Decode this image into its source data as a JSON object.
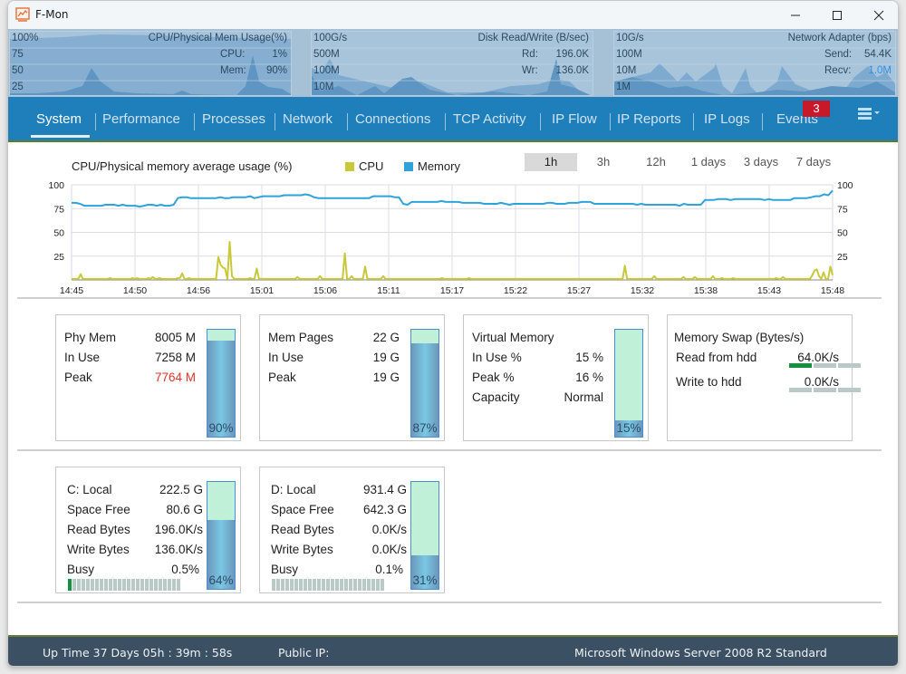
{
  "window": {
    "title": "F-Mon",
    "controls": {
      "minimize": "—",
      "maximize": "☐",
      "close": "✕"
    }
  },
  "mini_charts": [
    {
      "title": "CPU/Physical Mem Usage(%)",
      "ticks": [
        "100%",
        "75",
        "50",
        "25"
      ],
      "stats": [
        {
          "label": "CPU:",
          "value": "1%"
        },
        {
          "label": "Mem:",
          "value": "90%"
        }
      ]
    },
    {
      "title": "Disk Read/Write (B/sec)",
      "ticks": [
        "100G/s",
        "500M",
        "100M",
        "10M"
      ],
      "stats": [
        {
          "label": "Rd:",
          "value": "196.0K"
        },
        {
          "label": "Wr:",
          "value": "136.0K"
        }
      ]
    },
    {
      "title": "Network Adapter (bps)",
      "ticks": [
        "10G/s",
        "100M",
        "10M",
        "1M"
      ],
      "stats": [
        {
          "label": "Send:",
          "value": "54.4K"
        },
        {
          "label": "Recv:",
          "value": "1.0M",
          "color": "#2f8de4"
        }
      ]
    }
  ],
  "nav": {
    "tabs": [
      {
        "label": "System",
        "active": true
      },
      {
        "label": "Performance"
      },
      {
        "label": "Processes"
      },
      {
        "label": "Network"
      },
      {
        "label": "Connections"
      },
      {
        "label": "TCP Activity"
      },
      {
        "label": "IP Flow"
      },
      {
        "label": "IP Reports"
      },
      {
        "label": "IP Logs"
      },
      {
        "label": "Events"
      }
    ],
    "events_badge": "3",
    "menu_icon": "hamburger-menu-icon"
  },
  "usage_chart": {
    "title": "CPU/Physical memory average usage (%)",
    "legend": [
      {
        "label": "CPU",
        "color": "#c8c83a"
      },
      {
        "label": "Memory",
        "color": "#2ea2d9"
      }
    ],
    "ranges": [
      {
        "label": "1h",
        "active": true
      },
      {
        "label": "3h"
      },
      {
        "label": "12h"
      },
      {
        "label": "1 days"
      },
      {
        "label": "3 days"
      },
      {
        "label": "7 days"
      }
    ]
  },
  "chart_data": {
    "type": "line",
    "title": "CPU/Physical memory average usage (%)",
    "xlabel": "",
    "ylabel": "",
    "ylim": [
      0,
      100
    ],
    "y_ticks": [
      100,
      75,
      50,
      25
    ],
    "x_ticks": [
      "14:45",
      "14:50",
      "14:56",
      "15:01",
      "15:06",
      "15:11",
      "15:17",
      "15:22",
      "15:27",
      "15:32",
      "15:38",
      "15:43",
      "15:48"
    ],
    "grid": true,
    "legend_position": "top",
    "series": [
      {
        "name": "Memory",
        "color": "#2ea2d9",
        "values": [
          81,
          81,
          80,
          78,
          78,
          78,
          78,
          78,
          79,
          79,
          79,
          78,
          79,
          78,
          78,
          78,
          77,
          78,
          79,
          79,
          78,
          79,
          78,
          78,
          79,
          86,
          87,
          87,
          86,
          86,
          86,
          86,
          86,
          86,
          86,
          87,
          86,
          86,
          87,
          87,
          87,
          87,
          88,
          86,
          87,
          88,
          88,
          88,
          88,
          88,
          89,
          89,
          89,
          89,
          89,
          90,
          89,
          87,
          86,
          86,
          86,
          86,
          86,
          86,
          86,
          86,
          86,
          86,
          86,
          86,
          86,
          88,
          88,
          88,
          88,
          88,
          87,
          87,
          80,
          79,
          82,
          82,
          82,
          82,
          82,
          82,
          82,
          83,
          82,
          82,
          82,
          82,
          81,
          81,
          81,
          81,
          81,
          80,
          80,
          80,
          80,
          81,
          80,
          79,
          80,
          80,
          80,
          80,
          80,
          80,
          80,
          80,
          81,
          81,
          80,
          80,
          80,
          81,
          81,
          81,
          82,
          82,
          82,
          80,
          80,
          80,
          80,
          80,
          80,
          80,
          80,
          80,
          80,
          79,
          80,
          79,
          79,
          79,
          79,
          79,
          79,
          79,
          79,
          78,
          80,
          79,
          79,
          79,
          79,
          84,
          84,
          84,
          85,
          85,
          85,
          84,
          85,
          85,
          85,
          85,
          85,
          85,
          85,
          84,
          85,
          84,
          84,
          84,
          84,
          84,
          86,
          86,
          86,
          86,
          87,
          88,
          88,
          90,
          89,
          94
        ]
      },
      {
        "name": "CPU",
        "color": "#c8c83a",
        "values": [
          1,
          1,
          1,
          1,
          6,
          1,
          1,
          1,
          1,
          1,
          1,
          1,
          1,
          1,
          1,
          1,
          1,
          2,
          1,
          1,
          1,
          1,
          1,
          1,
          1,
          1,
          1,
          2,
          1,
          2,
          1,
          1,
          1,
          1,
          2,
          1,
          3,
          1,
          1,
          2,
          1,
          1,
          1,
          1,
          1,
          1,
          1,
          2,
          2,
          7,
          1,
          1,
          2,
          1,
          1,
          1,
          1,
          1,
          1,
          1,
          1,
          1,
          1,
          1,
          1,
          24,
          16,
          13,
          12,
          1,
          40,
          4,
          1,
          1,
          1,
          1,
          1,
          1,
          1,
          2,
          1,
          1,
          12,
          1,
          1,
          1,
          1,
          1,
          1,
          1,
          1,
          1,
          1,
          1,
          1,
          1,
          1,
          1,
          1,
          1,
          3,
          1,
          1,
          1,
          1,
          1,
          1,
          1,
          1,
          1,
          4,
          1,
          1,
          1,
          1,
          1,
          1,
          1,
          1,
          1,
          1,
          28,
          1,
          1,
          4,
          1,
          1,
          1,
          1,
          1,
          14,
          1,
          1,
          1,
          1,
          1,
          1,
          1,
          4,
          1,
          1,
          1,
          1,
          1,
          1,
          1,
          1,
          1,
          1,
          1,
          1,
          1,
          1,
          1,
          1,
          1,
          1,
          1,
          1,
          1,
          1,
          1,
          1,
          1,
          2,
          1,
          1,
          1,
          1,
          1,
          1,
          1,
          1,
          1,
          1,
          1,
          2,
          1,
          1,
          1,
          1,
          1,
          1,
          1,
          1,
          1,
          1,
          1,
          1,
          1,
          1,
          1,
          1,
          1,
          1,
          1,
          1,
          1,
          1,
          1,
          1,
          1,
          1,
          1,
          1,
          1,
          1,
          1,
          1,
          1,
          1,
          1,
          1,
          1,
          1,
          1,
          1,
          1,
          1,
          1,
          1,
          1,
          1,
          1,
          1,
          1,
          1,
          1,
          1,
          1,
          1,
          1,
          1,
          1,
          1,
          1,
          1,
          1,
          1,
          1,
          1,
          1,
          1,
          1,
          1,
          15,
          1,
          1,
          1,
          1,
          1,
          1,
          1,
          1,
          1,
          1,
          1,
          1,
          4,
          1,
          1,
          1,
          1,
          1,
          1,
          1,
          1,
          1,
          1,
          1,
          1,
          3,
          1,
          1,
          1,
          1,
          3,
          1,
          1,
          1,
          1,
          1,
          1,
          1,
          4,
          1,
          1,
          1,
          2,
          1,
          1,
          1,
          1,
          2,
          1,
          1,
          1,
          1,
          1,
          1,
          1,
          1,
          1,
          1,
          1,
          1,
          1,
          1,
          1,
          1,
          1,
          1,
          2,
          1,
          1,
          3,
          1,
          1,
          1,
          1,
          1,
          1,
          1,
          1,
          1,
          1,
          1,
          1,
          5,
          10,
          11,
          4,
          1,
          8,
          1,
          1,
          14,
          5
        ]
      }
    ]
  },
  "panels": {
    "phy_mem": {
      "rows": [
        {
          "label": "Phy Mem",
          "value": "8005 M"
        },
        {
          "label": "In Use",
          "value": "7258 M"
        },
        {
          "label": "Peak",
          "value": "7764 M",
          "highlight": true
        }
      ],
      "gauge_percent": 90,
      "gauge_label": "90%"
    },
    "mem_pages": {
      "rows": [
        {
          "label": "Mem Pages",
          "value": "22 G"
        },
        {
          "label": "In Use",
          "value": "19 G"
        },
        {
          "label": "Peak",
          "value": "19 G"
        }
      ],
      "gauge_percent": 87,
      "gauge_label": "87%"
    },
    "virtual_mem": {
      "rows": [
        {
          "label": "Virtual Memory",
          "value": ""
        },
        {
          "label": "In Use %",
          "value": "15 %"
        },
        {
          "label": "Peak %",
          "value": "16 %"
        },
        {
          "label": "Capacity",
          "value": "Normal"
        }
      ],
      "gauge_percent": 15,
      "gauge_label": "15%"
    },
    "mem_swap": {
      "title": "Memory Swap (Bytes/s)",
      "rows": [
        {
          "label": "Read from hdd",
          "value": "64.0K/s",
          "level": 0.33
        },
        {
          "label": "Write to hdd",
          "value": "0.0K/s",
          "level": 0
        }
      ]
    },
    "disk_c": {
      "rows": [
        {
          "label": "C: Local",
          "value": "222.5 G"
        },
        {
          "label": "Space Free",
          "value": "80.6 G"
        },
        {
          "label": "Read Bytes",
          "value": "196.0K/s"
        },
        {
          "label": "Write Bytes",
          "value": "136.0K/s"
        },
        {
          "label": "Busy",
          "value": "0.5%"
        }
      ],
      "busy_fraction": 0.005,
      "gauge_percent": 64,
      "gauge_label": "64%"
    },
    "disk_d": {
      "rows": [
        {
          "label": "D: Local",
          "value": "931.4 G"
        },
        {
          "label": "Space Free",
          "value": "642.3 G"
        },
        {
          "label": "Read Bytes",
          "value": "0.0K/s"
        },
        {
          "label": "Write Bytes",
          "value": "0.0K/s"
        },
        {
          "label": "Busy",
          "value": "0.1%"
        }
      ],
      "busy_fraction": 0.001,
      "gauge_percent": 31,
      "gauge_label": "31%"
    }
  },
  "status_bar": {
    "uptime": "Up Time  37 Days  05h : 39m : 58s",
    "public_ip": "Public IP:",
    "os": "Microsoft Windows Server 2008 R2 Standard"
  }
}
